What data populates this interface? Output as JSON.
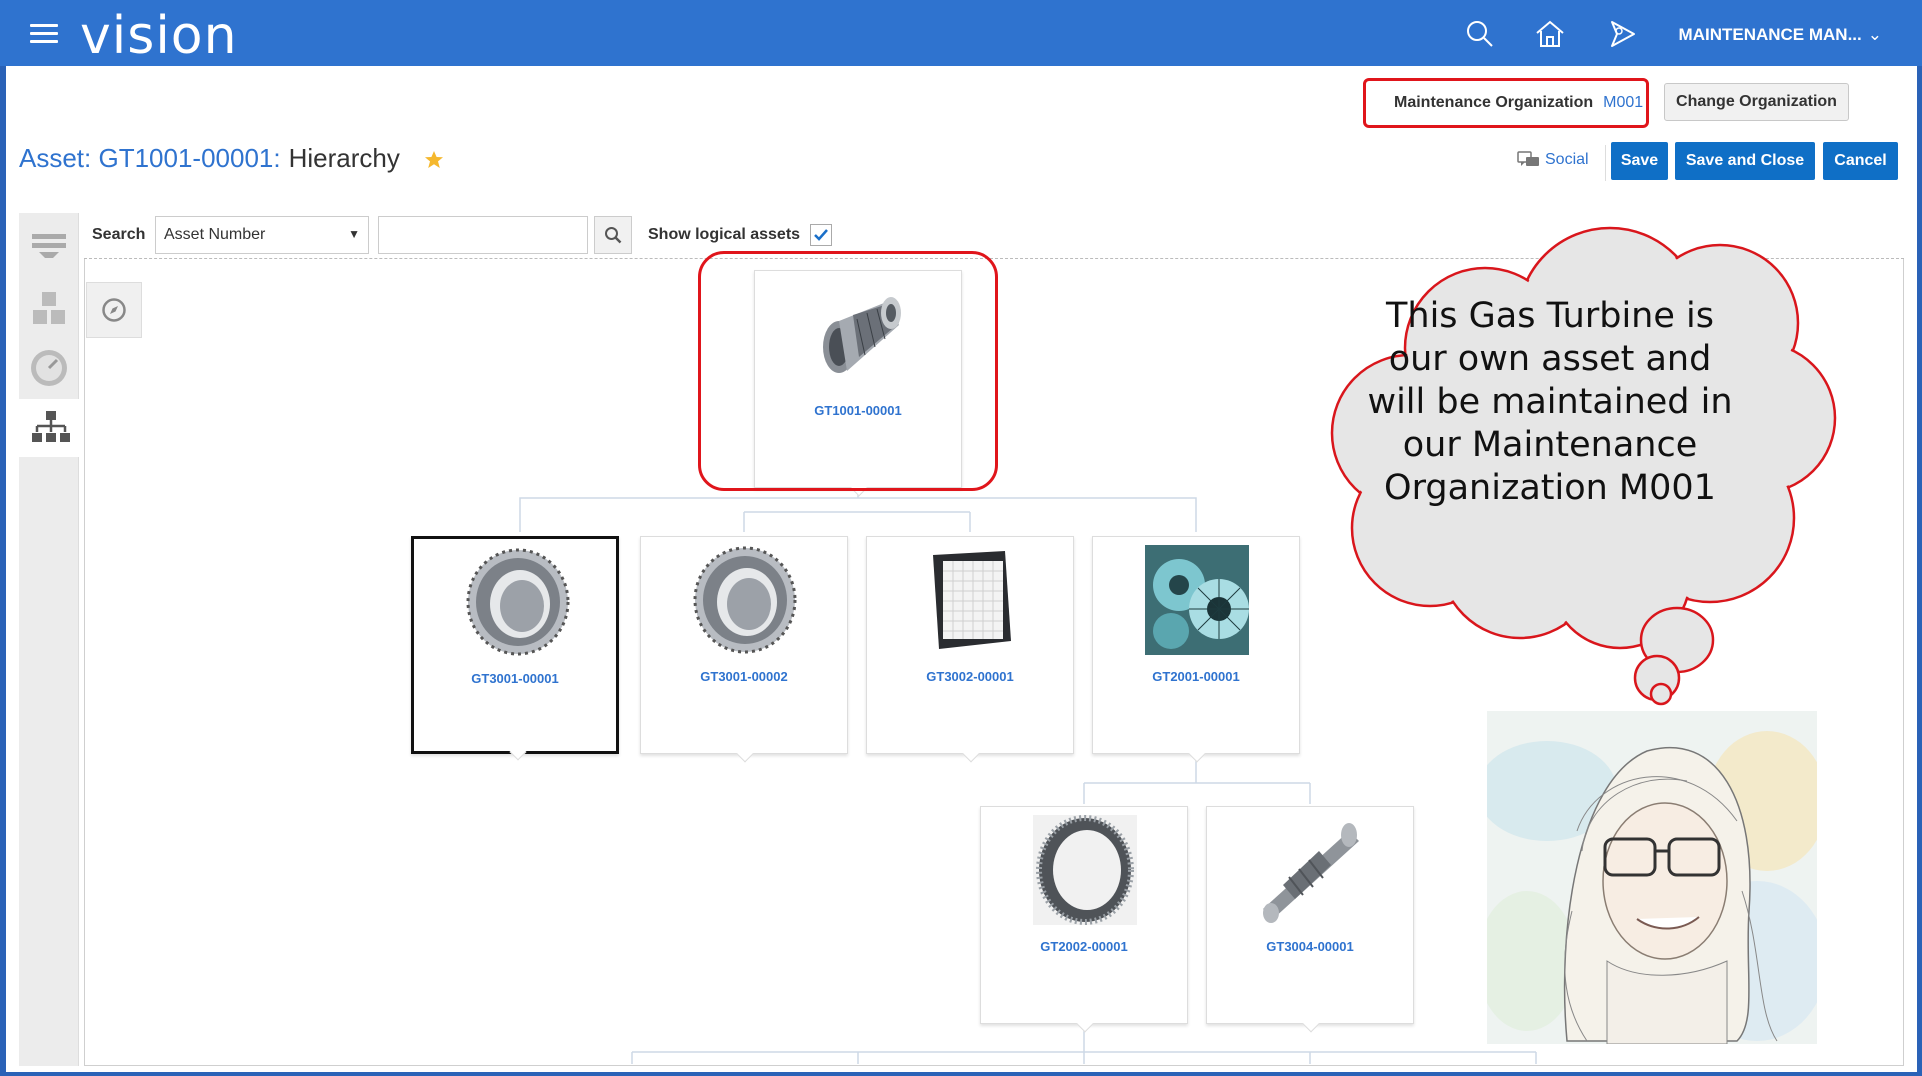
{
  "header": {
    "app_name": "vision",
    "user_menu": "MAINTENANCE MAN...",
    "icons": [
      "search-icon",
      "home-icon",
      "navigator-icon"
    ],
    "brand_color": "#2f73cf"
  },
  "org": {
    "label": "Maintenance Organization",
    "value": "M001",
    "change_button": "Change Organization"
  },
  "page": {
    "title": "Asset: GT1001-00001:",
    "subtitle": "Hierarchy",
    "social": "Social",
    "buttons": {
      "save": "Save",
      "save_close": "Save and Close",
      "cancel": "Cancel"
    }
  },
  "toolbar": {
    "search_label": "Search",
    "search_by": "Asset Number",
    "search_value": "",
    "show_logical_label": "Show logical assets",
    "show_logical_checked": true
  },
  "rail": [
    "panel-drawer-icon",
    "asset-blocks-icon",
    "meter-gauge-icon",
    "hierarchy-icon"
  ],
  "hierarchy": {
    "root": {
      "label": "GT1001-00001",
      "icon": "gas-turbine-image"
    },
    "level1": [
      {
        "label": "GT3001-00001",
        "icon": "turbine-ring-image",
        "selected": true
      },
      {
        "label": "GT3001-00002",
        "icon": "turbine-ring-image",
        "selected": false
      },
      {
        "label": "GT3002-00001",
        "icon": "air-filter-image",
        "selected": false
      },
      {
        "label": "GT2001-00001",
        "icon": "turbine-blades-image",
        "selected": false
      }
    ],
    "level2": [
      {
        "label": "GT2002-00001",
        "icon": "blade-wheel-image"
      },
      {
        "label": "GT3004-00001",
        "icon": "turbine-shaft-image"
      }
    ]
  },
  "callout": {
    "text": "This Gas Turbine is our own asset and will be maintained in our Maintenance Organization M001"
  }
}
